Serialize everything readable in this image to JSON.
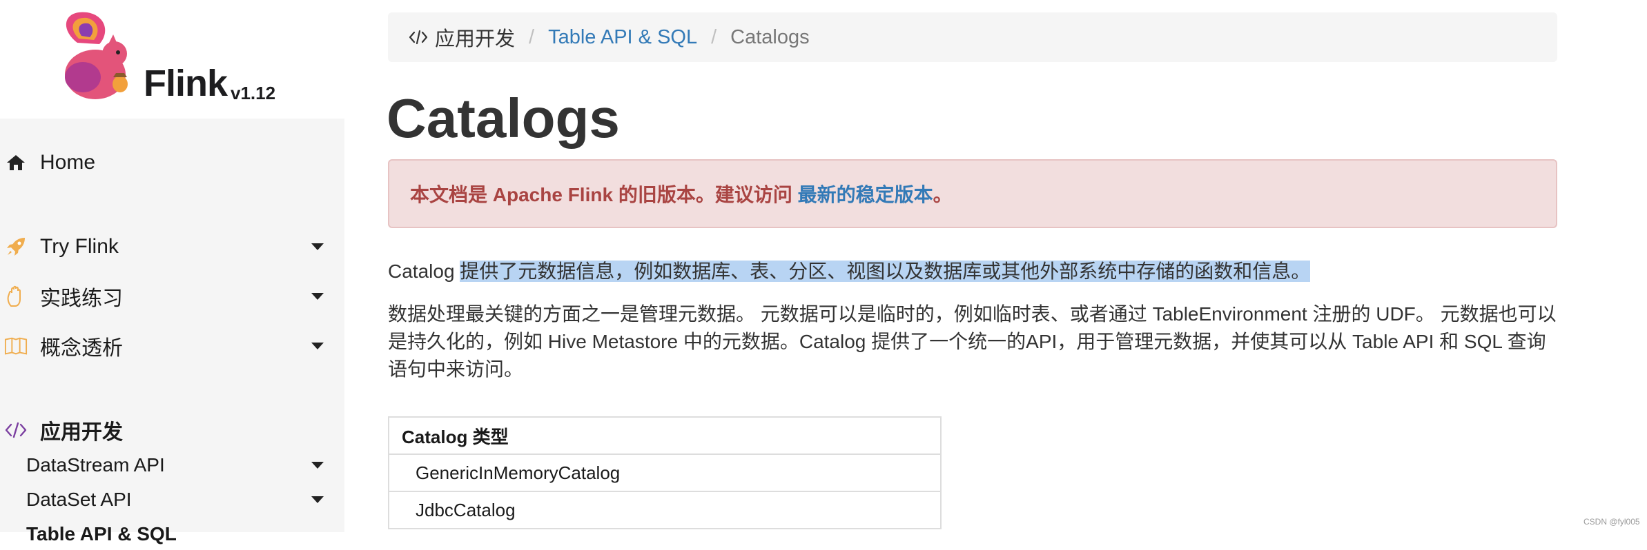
{
  "brand": {
    "name": "Flink",
    "version": "v1.12"
  },
  "sidebar": {
    "items": [
      {
        "label": "Home",
        "icon": "home-icon",
        "has_caret": false
      },
      {
        "label": "Try Flink",
        "icon": "rocket-icon",
        "has_caret": true
      },
      {
        "label": "实践练习",
        "icon": "hand-icon",
        "has_caret": true
      },
      {
        "label": "概念透析",
        "icon": "book-icon",
        "has_caret": true
      },
      {
        "label": "应用开发",
        "icon": "code-icon",
        "has_caret": false
      }
    ],
    "sub_items": [
      {
        "label": "DataStream API",
        "has_caret": true
      },
      {
        "label": "DataSet API",
        "has_caret": true
      },
      {
        "label": "Table API & SQL",
        "has_caret": false
      }
    ]
  },
  "breadcrumb": {
    "root": "应用开发",
    "separator": "/",
    "link": "Table API & SQL",
    "current": "Catalogs"
  },
  "page": {
    "title": "Catalogs"
  },
  "alert": {
    "text": "本文档是 Apache Flink 的旧版本。建议访问 ",
    "link": "最新的稳定版本",
    "end": "。"
  },
  "content": {
    "p1_start": "Catalog ",
    "p1_highlight": "提供了元数据信息，例如数据库、表、分区、视图以及数据库或其他外部系统中存储的函数和信息。",
    "p2": "数据处理最关键的方面之一是管理元数据。 元数据可以是临时的，例如临时表、或者通过 TableEnvironment 注册的 UDF。 元数据也可以是持久化的，例如 Hive Metastore 中的元数据。Catalog 提供了一个统一的API，用于管理元数据，并使其可以从 Table API 和 SQL 查询语句中来访问。"
  },
  "table": {
    "header": "Catalog 类型",
    "rows": [
      "GenericInMemoryCatalog",
      "JdbcCatalog"
    ]
  },
  "watermark": "CSDN @fyl005",
  "colors": {
    "link": "#337ab7",
    "alert_text": "#a94442",
    "alert_bg": "#f2dede",
    "highlight": "#b8d4f3",
    "sidebar_bg": "#f5f5f5",
    "rocket": "#f0ad4e"
  }
}
